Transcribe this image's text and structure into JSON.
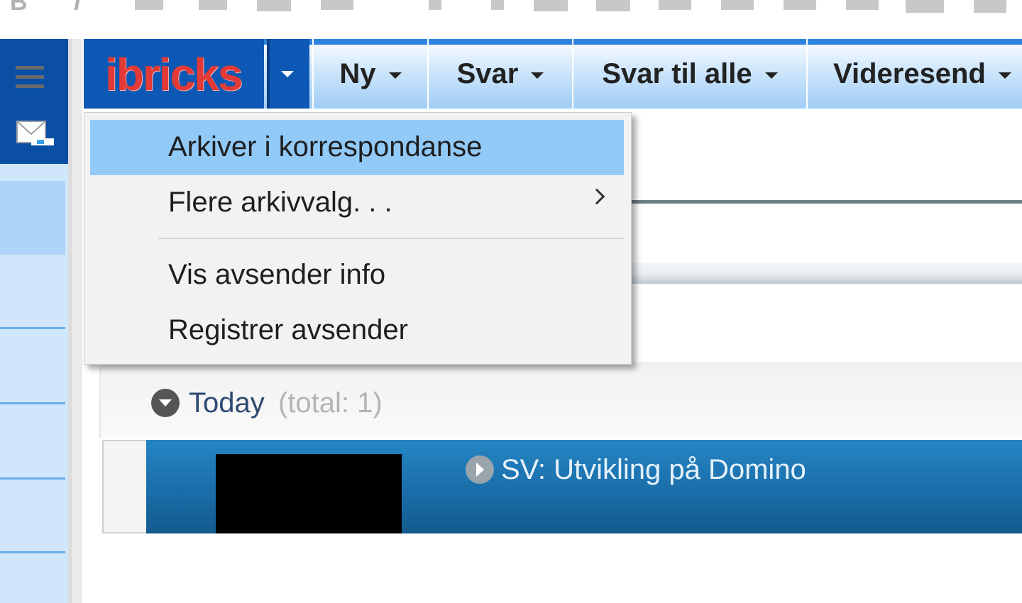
{
  "ribbon": {
    "logo_text": "ibricks",
    "buttons": [
      {
        "label": "Ny"
      },
      {
        "label": "Svar"
      },
      {
        "label": "Svar til alle"
      },
      {
        "label": "Videresend"
      }
    ]
  },
  "menu": {
    "items": [
      {
        "label": "Arkiver i korrespondanse"
      },
      {
        "label": "Flere arkivvalg. . ."
      },
      {
        "label": "Vis avsender info"
      },
      {
        "label": "Registrer avsender"
      }
    ]
  },
  "mail_list": {
    "group_title": "Today",
    "group_count": "(total: 1)",
    "rows": [
      {
        "subject": "SV: Utvikling på Domino"
      }
    ]
  },
  "colors": {
    "ribbon_blue": "#0d58b4",
    "menu_highlight": "#91c9f7",
    "selected_row": "#1a6ea9",
    "logo_red": "#e23a36"
  }
}
